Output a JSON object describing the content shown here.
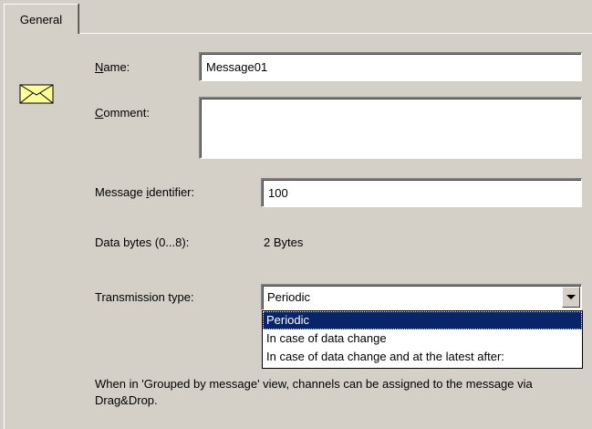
{
  "tabs": [
    {
      "label": "General",
      "active": true
    }
  ],
  "envelope_icon": "envelope-icon",
  "form": {
    "name_label": "Name:",
    "name_value": "Message01",
    "comment_label": "Comment:",
    "comment_value": "",
    "message_id_label": "Message identifier:",
    "message_id_value": "100",
    "data_bytes_label": "Data bytes (0...8):",
    "data_bytes_value": "2 Bytes",
    "transmission_label": "Transmission type:",
    "transmission_value": "Periodic",
    "transmission_options": [
      "Periodic",
      "In case of data change",
      "In case of data change  and at the latest after:"
    ],
    "transmission_selected_index": 0
  },
  "note": "When in 'Grouped by message' view, channels can be assigned to the message via Drag&Drop.",
  "colors": {
    "face": "#d4d0c8",
    "selection": "#0a246a",
    "envelope": "#ffff99"
  }
}
